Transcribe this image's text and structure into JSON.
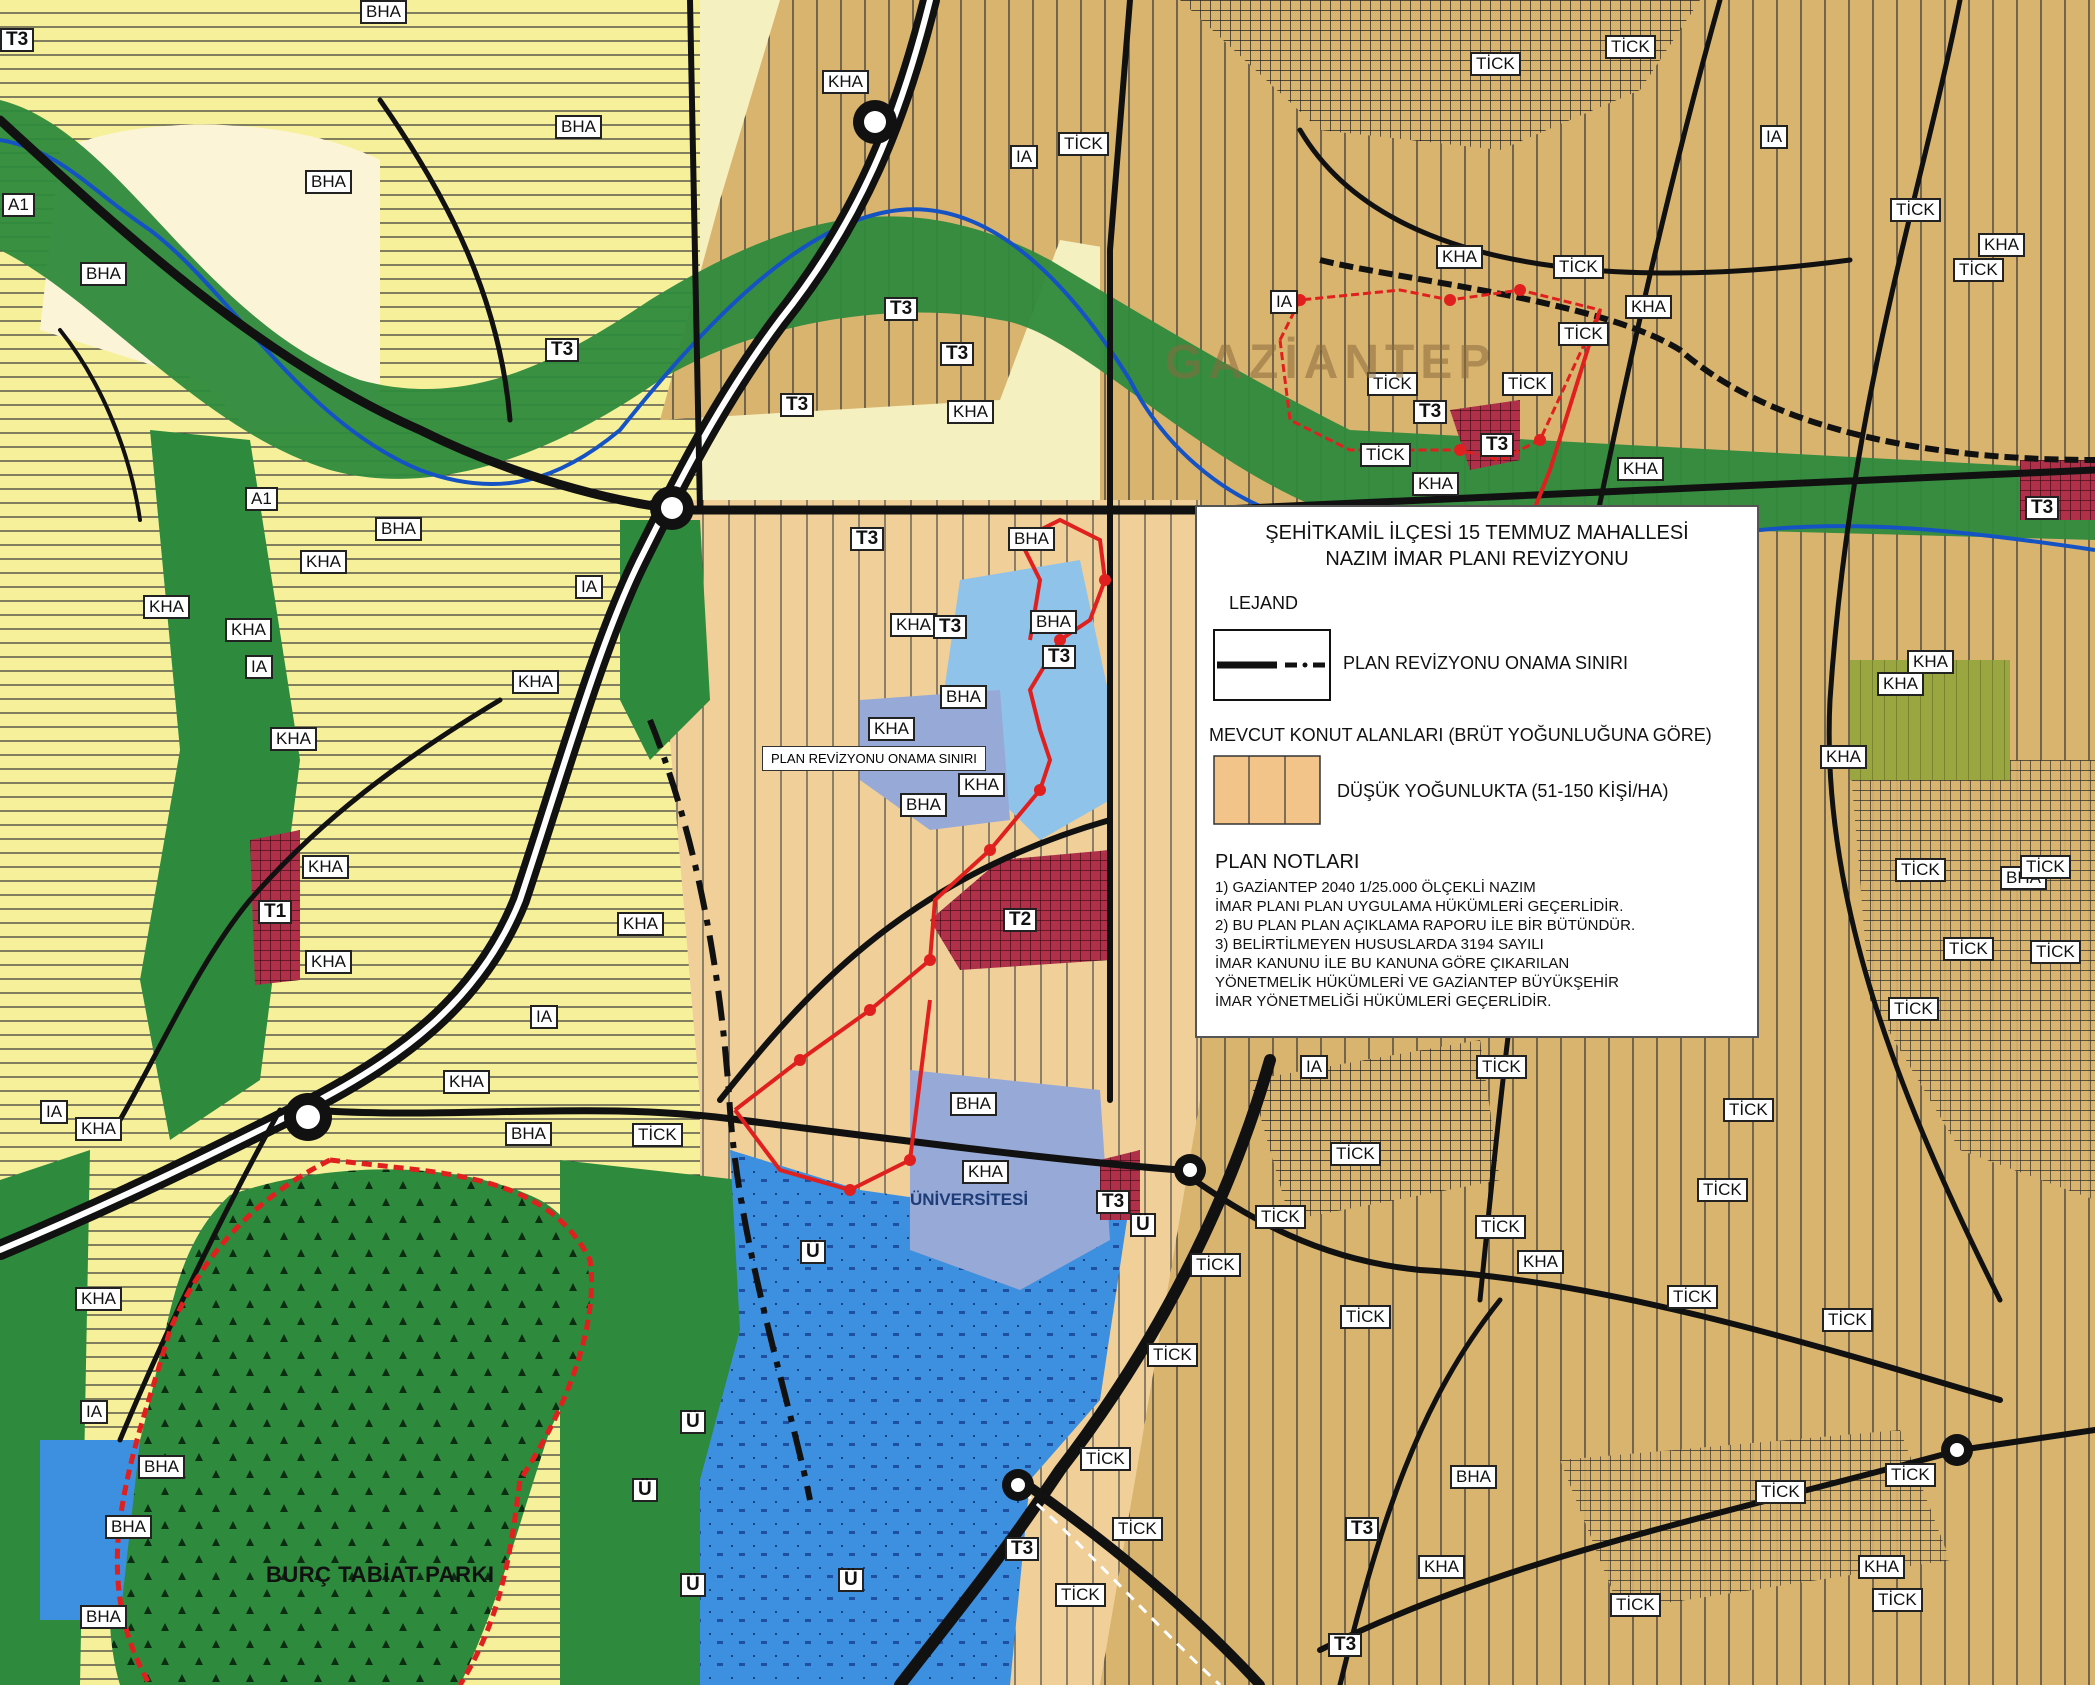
{
  "legend": {
    "title_line1": "ŞEHİTKAMİL İLÇESİ 15 TEMMUZ MAHALLESİ",
    "title_line2": "NAZIM İMAR PLANI  REVİZYONU",
    "section_legend": "LEJAND",
    "boundary_label": "PLAN REVİZYONU ONAMA SINIRI",
    "housing_header": "MEVCUT KONUT ALANLARI (BRÜT YOĞUNLUĞUNA GÖRE)",
    "housing_item": "DÜŞÜK YOĞUNLUKTA (51-150 KİŞİ/HA)",
    "notes_header": "PLAN NOTLARI",
    "notes": [
      "1)  GAZİANTEP 2040 1/25.000 ÖLÇEKLİ NAZIM",
      "İMAR PLANI PLAN UYGULAMA HÜKÜMLERİ GEÇERLİDİR.",
      "2)  BU PLAN PLAN AÇIKLAMA RAPORU İLE BİR BÜTÜNDÜR.",
      "3)  BELİRTİLMEYEN HUSUSLARDA 3194 SAYILI",
      "İMAR KANUNU İLE BU KANUNA GÖRE ÇIKARILAN",
      "YÖNETMELİK HÜKÜMLERİ VE GAZİANTEP BÜYÜKŞEHİR",
      " İMAR YÖNETMELİĞİ HÜKÜMLERİ GEÇERLİDİR."
    ]
  },
  "callout": "PLAN REVİZYONU ONAMA SINIRI",
  "park_name": "BURÇ TABİAT PARKI",
  "district_word": "GAZİANTEP",
  "university_word": "ÜNİVERSİTESİ",
  "zone_labels": {
    "ia": "IA",
    "bha": "BHA",
    "kha": "KHA",
    "tick": "TİCK",
    "t1": "T1",
    "t2": "T2",
    "t3": "T3",
    "u": "Ü",
    "a1": "A1"
  },
  "colors": {
    "forest": "#2e8a3c",
    "yellow_res": "#f7f09a",
    "tan_res": "#d9b46e",
    "beige_res": "#f2d49a",
    "university": "#3d8fe0",
    "light_blue": "#8fc3ea",
    "commercial": "#b0304a",
    "boundary": "#e0201e",
    "road": "#111111"
  }
}
